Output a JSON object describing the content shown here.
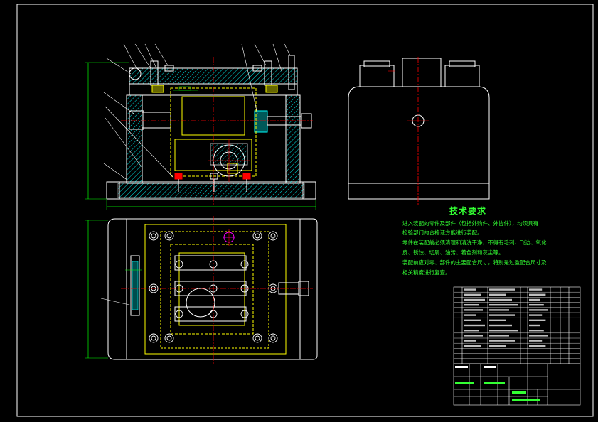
{
  "technical_requirements": {
    "title": "技术要求",
    "lines": [
      "进入装配的零件及部件（包括外购件、外协件），均须具有",
      "检验部门的合格证方能进行装配。",
      "零件在装配前必须清理和清洗干净，不得有毛刺、飞边、氧化",
      "皮、锈蚀、切屑、油污、着色剂和灰尘等。",
      "装配前应对零、部件的主要配合尺寸，特别是过盈配合尺寸及",
      "相关精度进行复查。"
    ]
  },
  "colors": {
    "background": "#000000",
    "outline": "#ffffff",
    "hidden": "#ffff00",
    "center": "#ff0000",
    "dimension": "#00ff00",
    "hatch": "#00ffff",
    "accent": "#ff00ff"
  }
}
